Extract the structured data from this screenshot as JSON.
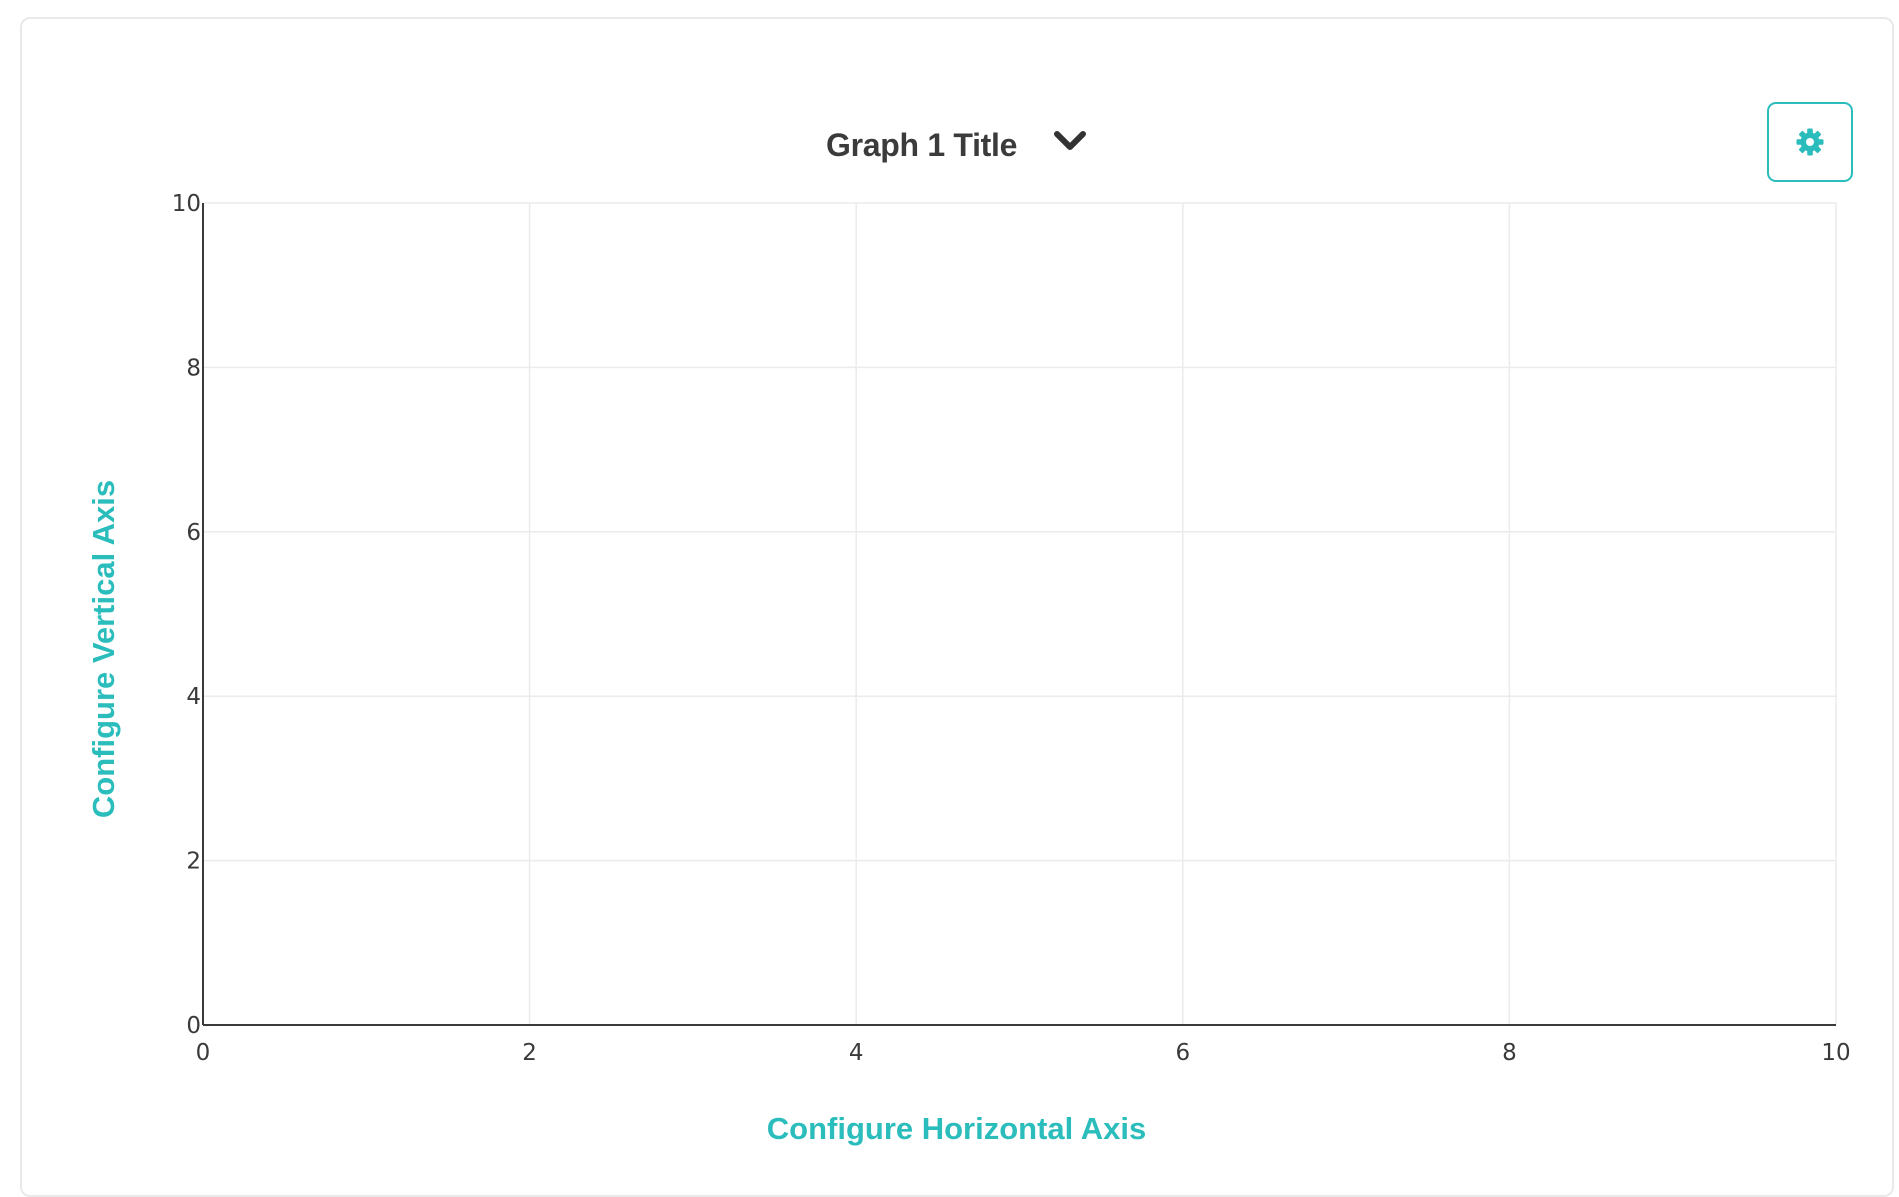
{
  "header": {
    "graph_title": "Graph 1 Title",
    "dropdown_icon": "chevron-down-icon",
    "settings_icon": "gear-icon"
  },
  "colors": {
    "accent": "#2bbcbc",
    "title_text": "#3b3b3b",
    "grid": "#ebebeb",
    "axis_line": "#3a3a3a"
  },
  "chart_data": {
    "type": "scatter",
    "title": "Graph 1 Title",
    "xlabel": "Configure Horizontal Axis",
    "ylabel": "Configure Vertical Axis",
    "xlim": [
      0,
      10
    ],
    "ylim": [
      0,
      10
    ],
    "xticks": [
      "0",
      "2",
      "4",
      "6",
      "8",
      "10"
    ],
    "yticks": [
      "0",
      "2",
      "4",
      "6",
      "8",
      "10"
    ],
    "grid": true,
    "legend": "none",
    "series": []
  }
}
